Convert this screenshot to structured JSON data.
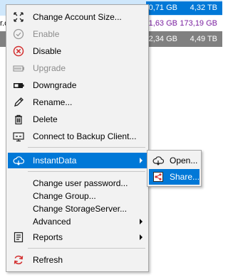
{
  "background_rows": [
    {
      "left": "",
      "size": "0,71 GB",
      "capacity": "4,32 TB"
    },
    {
      "left": "r.c",
      "size": "1,63 GB",
      "capacity": "173,19 GB"
    },
    {
      "left": "",
      "size": "2,34 GB",
      "capacity": "4,49 TB"
    }
  ],
  "menu": {
    "items": [
      {
        "label": "Change Account Size...",
        "icon": "resize-arrows-icon",
        "enabled": true
      },
      {
        "label": "Enable",
        "icon": "check-circle-icon",
        "enabled": false
      },
      {
        "label": "Disable",
        "icon": "x-circle-icon",
        "enabled": true
      },
      {
        "label": "Upgrade",
        "icon": "upgrade-battery-icon",
        "enabled": false
      },
      {
        "label": "Downgrade",
        "icon": "downgrade-battery-icon",
        "enabled": true
      },
      {
        "label": "Rename...",
        "icon": "pencil-icon",
        "enabled": true
      },
      {
        "label": "Delete",
        "icon": "trash-icon",
        "enabled": true
      },
      {
        "label": "Connect to Backup Client...",
        "icon": "monitor-icon",
        "enabled": true
      },
      {
        "label": "InstantData",
        "icon": "cloud-icon",
        "enabled": true,
        "highlighted": true,
        "submenu": true
      },
      {
        "label": "Change user password...",
        "enabled": true
      },
      {
        "label": "Change Group...",
        "enabled": true
      },
      {
        "label": "Change StorageServer...",
        "enabled": true
      },
      {
        "label": "Advanced",
        "enabled": true,
        "submenu": true
      },
      {
        "label": "Reports",
        "icon": "report-icon",
        "enabled": true,
        "submenu": true
      },
      {
        "label": "Refresh",
        "icon": "refresh-icon",
        "enabled": true
      }
    ]
  },
  "submenu": {
    "items": [
      {
        "label": "Open...",
        "icon": "cloud-icon"
      },
      {
        "label": "Share...",
        "icon": "share-icon",
        "highlighted": true
      }
    ]
  },
  "colors": {
    "highlight": "#0078d7",
    "menu_background": "#f2f2f2",
    "disabled_text": "#8c8c8c",
    "delete_red": "#d32f2f"
  }
}
